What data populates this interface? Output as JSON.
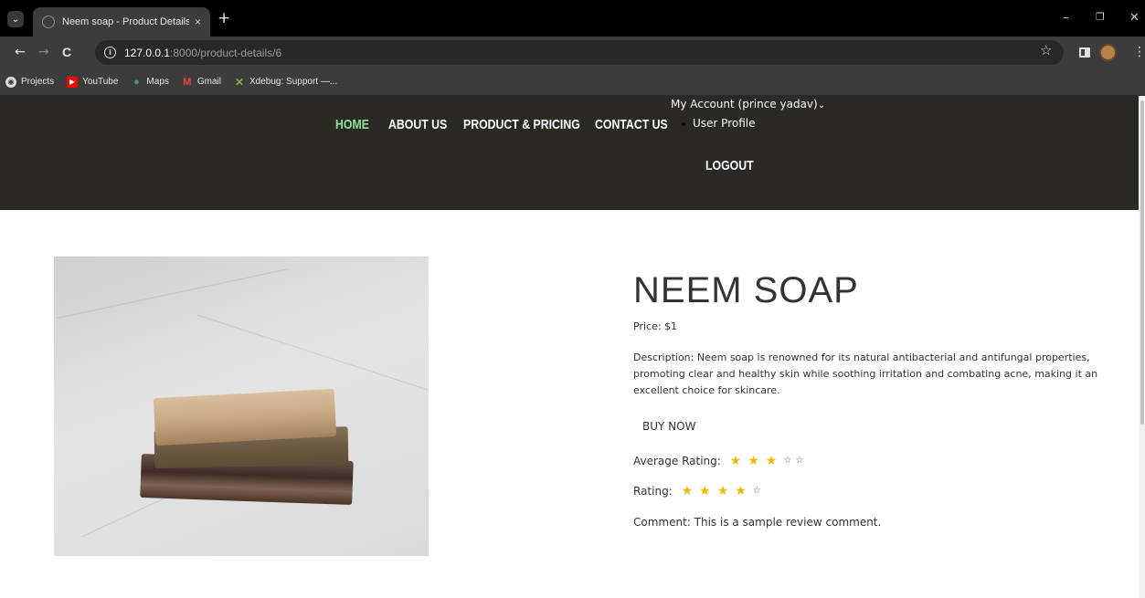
{
  "browser": {
    "tab_title": "Neem soap - Product Details",
    "tab_close": "×",
    "new_tab": "+",
    "url_host": "127.0.0.1",
    "url_path": ":8000/product-details/6",
    "window_min": "–",
    "window_restore": "❐",
    "window_close": "✕",
    "back": "←",
    "forward": "→",
    "reload": "C",
    "info": "i",
    "bookmark_star": "☆",
    "menu": "⋮",
    "bookmarks": [
      {
        "label": "Projects",
        "icon": "globe-icon",
        "color": "#dddddd"
      },
      {
        "label": "YouTube",
        "icon": "youtube-icon",
        "color": "#ff0000"
      },
      {
        "label": "Maps",
        "icon": "maps-icon",
        "color": "#34a853"
      },
      {
        "label": "Gmail",
        "icon": "gmail-icon",
        "color": "#ea4335"
      },
      {
        "label": "Xdebug: Support —...",
        "icon": "xdebug-icon",
        "color": "#7cb342"
      }
    ]
  },
  "site": {
    "nav": {
      "home": "HOME",
      "about": "ABOUT US",
      "products": "PRODUCT & PRICING",
      "contact": "CONTACT US"
    },
    "account": "My Account (prince yadav)",
    "account_chevron": "⌄",
    "user_profile": "User Profile",
    "logout": "LOGOUT",
    "active_nav_color": "#8fe29b",
    "header_bg": "#2c2925"
  },
  "product": {
    "title": "NEEM SOAP",
    "price": "Price: $1",
    "description": "Description: Neem soap is renowned for its natural antibacterial and antifungal properties, promoting clear and healthy skin while soothing irritation and combating acne, making it an excellent choice for skincare.",
    "buy_label": "BUY NOW",
    "average_rating_label": "Average Rating:",
    "average_rating": 3,
    "rating_label": "Rating:",
    "rating": 4,
    "rating_max": 5,
    "full_star": "★",
    "empty_star": "☆",
    "comment": "Comment: This is a sample review comment."
  }
}
